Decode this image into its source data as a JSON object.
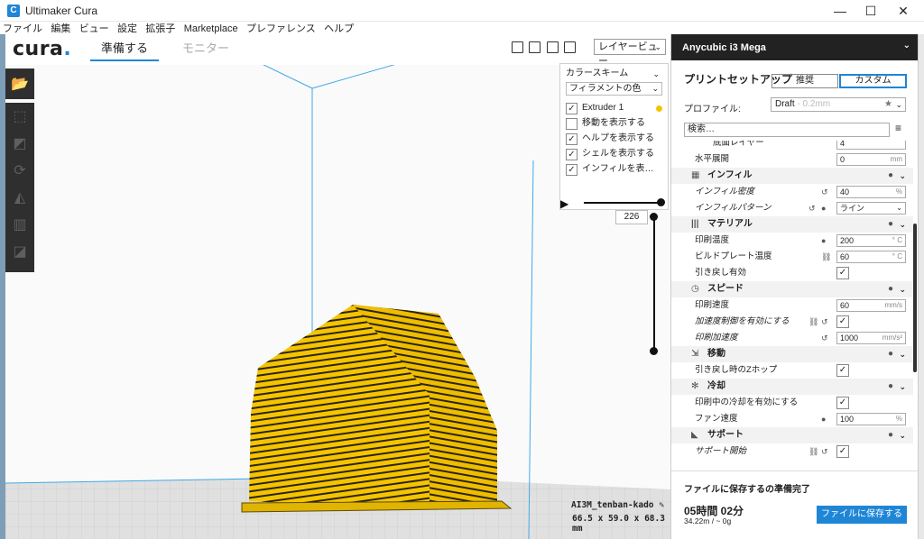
{
  "window": {
    "title": "Ultimaker Cura",
    "app_icon": "C",
    "controls": [
      "—",
      "☐",
      "✕"
    ]
  },
  "menu": [
    "ファイル",
    "編集",
    "ビュー",
    "設定",
    "拡張子",
    "Marketplace",
    "プレファレンス",
    "ヘルプ"
  ],
  "header": {
    "logo": "cura",
    "tabs": [
      {
        "label": "準備する",
        "active": true
      },
      {
        "label": "モニター",
        "active": false
      }
    ],
    "view_select": "レイヤービュー"
  },
  "color_panel": {
    "title": "カラースキーム",
    "scheme": "フィラメントの色",
    "items": [
      {
        "label": "Extruder 1",
        "checked": true
      },
      {
        "label": "移動を表示する",
        "checked": false
      },
      {
        "label": "ヘルプを表示する",
        "checked": true
      },
      {
        "label": "シェルを表示する",
        "checked": true
      },
      {
        "label": "インフィルを表…",
        "checked": true
      }
    ]
  },
  "layer": {
    "current": "226"
  },
  "object": {
    "name": "AI3M_tenban-kado",
    "dims": "66.5 x 59.0 x 68.3 mm"
  },
  "sidebar": {
    "printer": "Anycubic i3 Mega",
    "setup_title": "プリントセットアップ",
    "mode_recommended": "推奨",
    "mode_custom": "カスタム",
    "profile_label": "プロファイル:",
    "profile_value": "Draft",
    "profile_sub": " - 0.2mm",
    "search_placeholder": "検索…",
    "partial_row": {
      "label": "底面レイヤー",
      "value": "4"
    },
    "rows": [
      {
        "type": "setting",
        "label": "水平展開",
        "value": "0",
        "unit": "mm"
      },
      {
        "type": "section",
        "label": "インフィル",
        "icon": "▦"
      },
      {
        "type": "setting",
        "label": "インフィル密度",
        "value": "40",
        "unit": "%",
        "italic": true,
        "reset": true
      },
      {
        "type": "setting",
        "label": "インフィルパターン",
        "value": "ライン",
        "dropdown": true,
        "italic": true,
        "reset": true,
        "info": true
      },
      {
        "type": "section",
        "label": "マテリアル",
        "icon": "|||"
      },
      {
        "type": "setting",
        "label": "印刷温度",
        "value": "200",
        "unit": "° C",
        "info": true
      },
      {
        "type": "setting",
        "label": "ビルドプレート温度",
        "value": "60",
        "unit": "° C",
        "link": true
      },
      {
        "type": "check",
        "label": "引き戻し有効",
        "checked": true
      },
      {
        "type": "section",
        "label": "スピード",
        "icon": "◷"
      },
      {
        "type": "setting",
        "label": "印刷速度",
        "value": "60",
        "unit": "mm/s"
      },
      {
        "type": "check",
        "label": "加速度制御を有効にする",
        "checked": true,
        "italic": true,
        "link": true,
        "reset": true
      },
      {
        "type": "setting",
        "label": "印刷加速度",
        "value": "1000",
        "unit": "mm/s²",
        "italic": true,
        "reset": true
      },
      {
        "type": "section",
        "label": "移動",
        "icon": "⇲"
      },
      {
        "type": "check",
        "label": "引き戻し時のZホップ",
        "checked": true
      },
      {
        "type": "section",
        "label": "冷却",
        "icon": "✻"
      },
      {
        "type": "check",
        "label": "印刷中の冷却を有効にする",
        "checked": true
      },
      {
        "type": "setting",
        "label": "ファン速度",
        "value": "100",
        "unit": "%",
        "info": true
      },
      {
        "type": "section",
        "label": "サポート",
        "icon": "◣"
      },
      {
        "type": "check",
        "label": "サポート開始",
        "checked": true,
        "italic": true,
        "link": true,
        "reset": true
      }
    ],
    "footer": {
      "ready": "ファイルに保存するの準備完了",
      "time": "05時間 02分",
      "material": "34.22m / ~ 0g",
      "save": "ファイルに保存する"
    }
  },
  "colors": {
    "accent": "#1f86d6",
    "model": "#f5c400",
    "dark": "#222222"
  }
}
